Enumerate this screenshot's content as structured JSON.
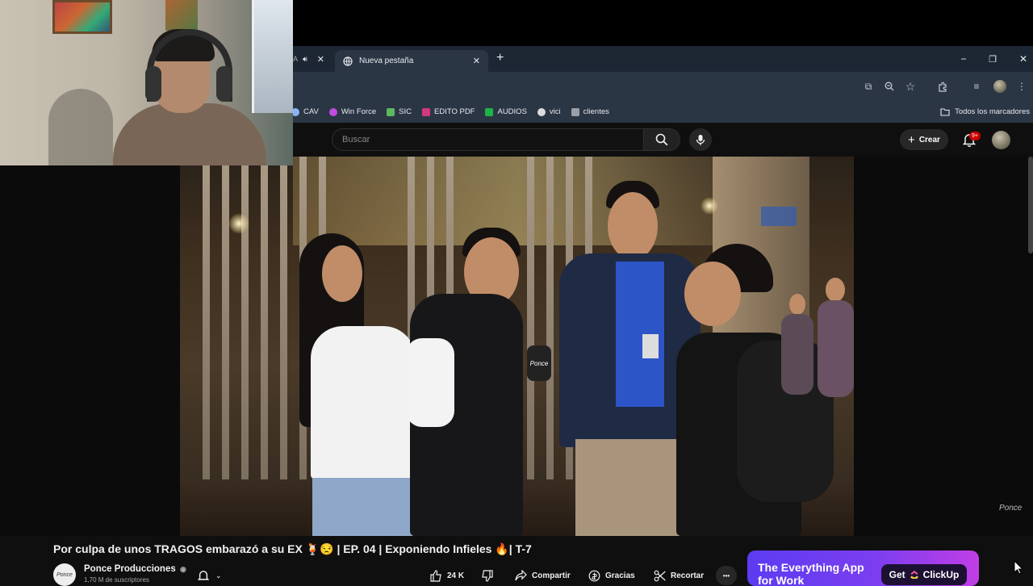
{
  "browser": {
    "active_tab_title": "Nueva pestaña",
    "prev_tab_text": "A",
    "window_controls": {
      "minimize": "−",
      "maximize": "❐",
      "close": "✕"
    }
  },
  "bookmarks": {
    "items": [
      {
        "label": "CAV",
        "icon": "globe-icon",
        "color": "#8ab4f8"
      },
      {
        "label": "Win Force",
        "icon": "bookmark-icon",
        "color": "#c04ce0"
      },
      {
        "label": "SIC",
        "icon": "bookmark-icon",
        "color": "#5cb85c"
      },
      {
        "label": "EDITO PDF",
        "icon": "pdf-icon",
        "color": "#d33a7a"
      },
      {
        "label": "AUDIOS",
        "icon": "vimeo-icon",
        "color": "#1eb346"
      },
      {
        "label": "vici",
        "icon": "globe-icon",
        "color": "#dddddd"
      },
      {
        "label": "clientes",
        "icon": "bookmark-icon",
        "color": "#9aa0a6"
      }
    ],
    "all_bookmarks": "Todos los marcadores"
  },
  "youtube": {
    "search_placeholder": "Buscar",
    "create_label": "Crear",
    "notif_badge": "9+",
    "video_title": "Por culpa de unos TRAGOS embarazó a su EX 🍹😒 | EP. 04 | Exponiendo Infieles 🔥| T-7",
    "channel_name": "Ponce Producciones",
    "channel_avatar_text": "Ponce",
    "subscribers": "1,70 M de suscriptores",
    "likes": "24 K",
    "share_label": "Compartir",
    "thanks_label": "Gracias",
    "clip_label": "Recortar",
    "more_label": "•••",
    "watermark": "Ponce",
    "brand_color": "#cc0000"
  },
  "ad": {
    "headline_line1": "The Everything App",
    "headline_line2": "for Work",
    "cta_prefix": "Get",
    "cta_brand": "ClickUp"
  }
}
